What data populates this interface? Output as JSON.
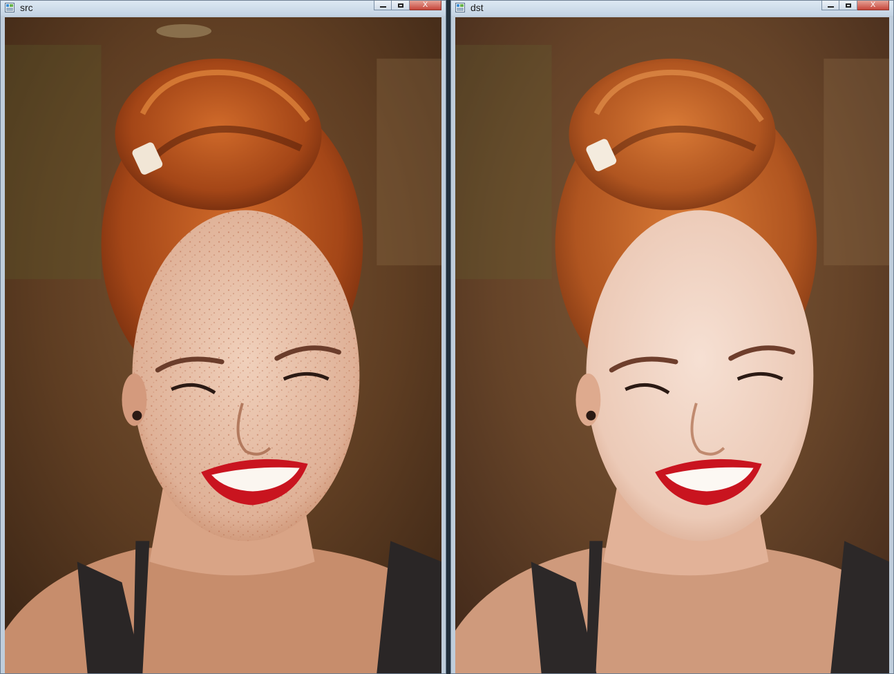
{
  "windows": [
    {
      "title": "src",
      "controls": {
        "minimize": "minimize",
        "maximize": "maximize",
        "close": "X"
      }
    },
    {
      "title": "dst",
      "controls": {
        "minimize": "minimize",
        "maximize": "maximize",
        "close": "X"
      }
    }
  ],
  "colors": {
    "background_bokeh": "#6b4326",
    "hair": "#b4521f",
    "skin_src": "#e9c4ad",
    "skin_dst": "#f0d3c4",
    "lips": "#c9141f",
    "top": "#2a2626"
  }
}
